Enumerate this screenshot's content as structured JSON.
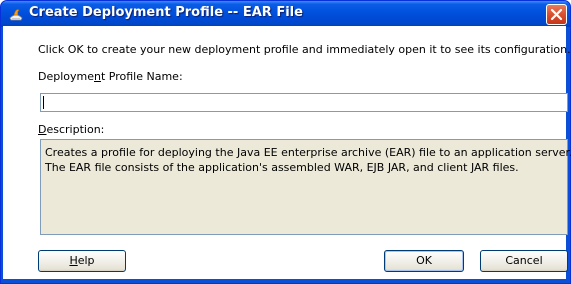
{
  "window": {
    "title": "Create Deployment Profile -- EAR File",
    "icon": "jdeveloper-icon",
    "close_icon": "close-icon"
  },
  "dialog": {
    "info_text": "Click OK to create your new deployment profile and immediately open it to see its configuration.",
    "name_label_before": "Deployme",
    "name_label_mnemonic": "n",
    "name_label_after": "t Profile Name:",
    "name_value": "",
    "description_label_mnemonic": "D",
    "description_label_after": "escription:",
    "description_lines": [
      "Creates a profile for deploying the Java EE enterprise archive (EAR) file to an application server.",
      "The EAR file consists of the application's assembled WAR, EJB JAR, and client JAR files."
    ]
  },
  "buttons": {
    "help_mnemonic": "H",
    "help_rest": "elp",
    "ok": "OK",
    "cancel": "Cancel"
  },
  "colors": {
    "titlebar": "#0152de",
    "window_border": "#0831d9",
    "close_button": "#d94f2f",
    "description_bg": "#ece9d8"
  }
}
